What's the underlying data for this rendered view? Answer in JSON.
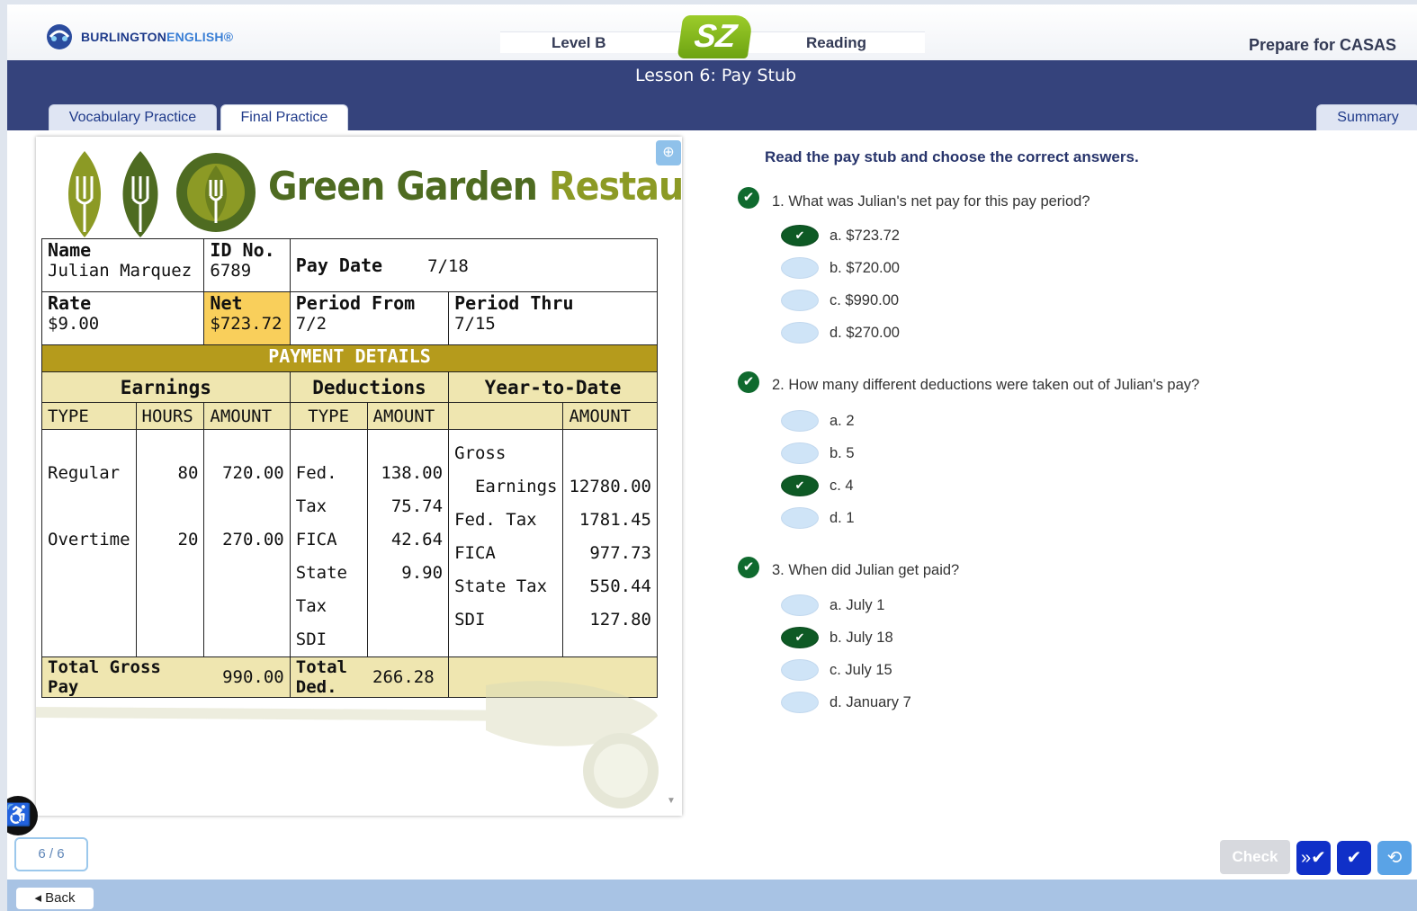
{
  "header": {
    "brand_a": "BURLINGTON",
    "brand_b": "ENGLISH®",
    "level": "Level B",
    "badge": "SZ",
    "skill": "Reading",
    "prepare": "Prepare for CASAS"
  },
  "lesson": {
    "title": "Lesson 6: Pay Stub",
    "tabs": [
      "Vocabulary Practice",
      "Final Practice"
    ],
    "summary": "Summary"
  },
  "stub": {
    "restaurant_a": "Green Garden",
    "restaurant_b": "Restaurant",
    "name_label": "Name",
    "name_value": "Julian Marquez",
    "id_label": "ID No.",
    "id_value": "6789",
    "paydate_label": "Pay Date",
    "paydate_value": "7/18",
    "rate_label": "Rate",
    "rate_value": "$9.00",
    "net_label": "Net",
    "net_value": "$723.72",
    "from_label": "Period From",
    "from_value": "7/2",
    "thru_label": "Period Thru",
    "thru_value": "7/15",
    "payment_details": "PAYMENT DETAILS",
    "earnings": "Earnings",
    "deductions": "Deductions",
    "ytd": "Year-to-Date",
    "col_type": "TYPE",
    "col_hours": "HOURS",
    "col_amount": "AMOUNT",
    "earn_types": "Regular\n\nOvertime",
    "earn_hours": "80\n\n20",
    "earn_amounts": "720.00\n\n270.00",
    "ded_types": "Fed. Tax\nFICA\nState Tax\nSDI",
    "ded_amounts": "138.00\n75.74\n42.64\n9.90",
    "ytd_types": "Gross\n  Earnings\nFed. Tax\nFICA\nState Tax\nSDI",
    "ytd_amounts": "\n12780.00\n1781.45\n977.73\n550.44\n127.80",
    "total_gross_label": "Total Gross Pay",
    "total_gross_value": "990.00",
    "total_ded_label": "Total Ded.",
    "total_ded_value": "266.28"
  },
  "instruction": "Read the pay stub and choose the correct answers.",
  "questions": [
    {
      "text": "1. What was Julian's net pay for this pay period?",
      "options": [
        "a. $723.72",
        "b. $720.00",
        "c. $990.00",
        "d. $270.00"
      ],
      "selected": 0
    },
    {
      "text": "2. How many different deductions were taken out of Julian's pay?",
      "options": [
        "a. 2",
        "b. 5",
        "c. 4",
        "d. 1"
      ],
      "selected": 2
    },
    {
      "text": "3. When did Julian get paid?",
      "options": [
        "a. July 1",
        "b. July 18",
        "c. July 15",
        "d. January 7"
      ],
      "selected": 1
    }
  ],
  "footer": {
    "page_counter": "6 / 6",
    "check": "Check",
    "back": "Back"
  },
  "colors": {
    "navy": "#35437c",
    "selected_green": "#0e5a25",
    "unselected_blue": "#cfe4f7"
  }
}
